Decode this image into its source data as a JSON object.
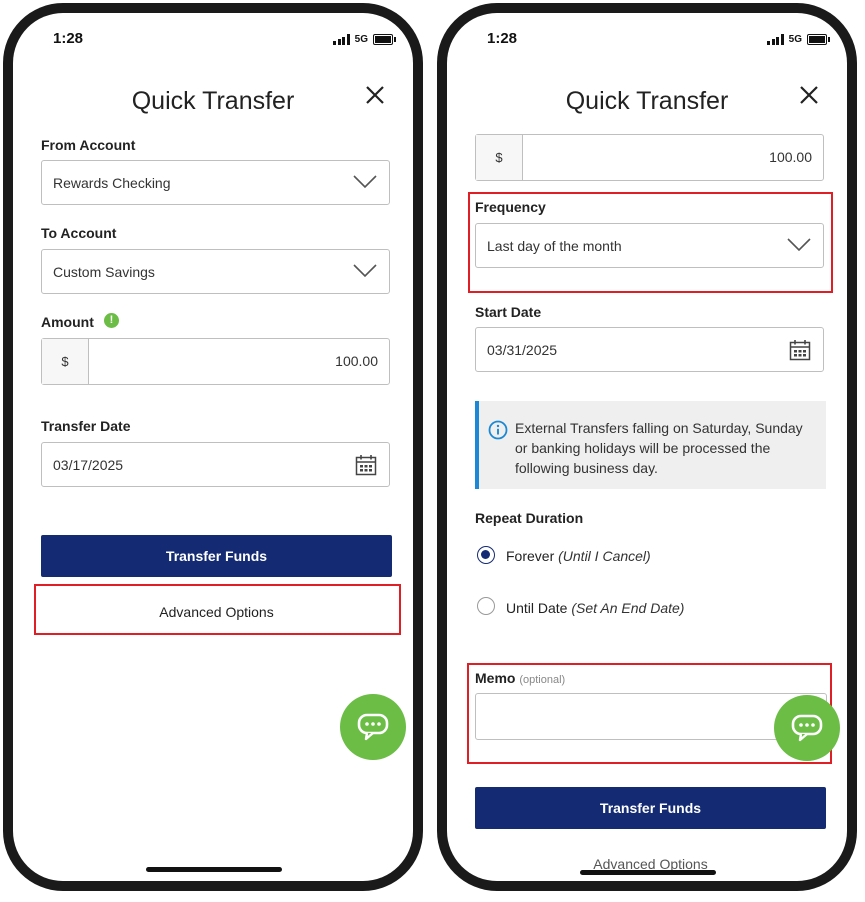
{
  "status": {
    "time": "1:28",
    "network": "5G"
  },
  "left": {
    "title": "Quick Transfer",
    "from_account": {
      "label": "From Account",
      "value": "Rewards Checking"
    },
    "to_account": {
      "label": "To Account",
      "value": "Custom Savings"
    },
    "amount": {
      "label": "Amount",
      "currency": "$",
      "value": "100.00"
    },
    "transfer_date": {
      "label": "Transfer Date",
      "value": "03/17/2025"
    },
    "transfer_button": "Transfer Funds",
    "advanced_options": "Advanced Options"
  },
  "right": {
    "title": "Quick Transfer",
    "amount": {
      "currency": "$",
      "value": "100.00"
    },
    "frequency": {
      "label": "Frequency",
      "value": "Last day of the month"
    },
    "start_date": {
      "label": "Start Date",
      "value": "03/31/2025"
    },
    "info_text": "External Transfers falling on Saturday, Sunday or banking holidays will be processed the following business day.",
    "repeat_duration": {
      "label": "Repeat Duration",
      "options": [
        {
          "label": "Forever",
          "hint": "(Until I Cancel)",
          "selected": true
        },
        {
          "label": "Until Date",
          "hint": "(Set An End Date)",
          "selected": false
        }
      ]
    },
    "memo": {
      "label": "Memo",
      "optional": "(optional)",
      "value": ""
    },
    "transfer_button": "Transfer Funds",
    "advanced_options": "Advanced Options"
  },
  "colors": {
    "primary": "#142b73",
    "highlight": "#e01e25",
    "chat": "#6bbd45",
    "info_bar": "#1a88d4"
  },
  "icons": [
    "close-icon",
    "chevron-down-icon",
    "calendar-icon",
    "info-icon",
    "chat-icon",
    "alert-icon"
  ]
}
